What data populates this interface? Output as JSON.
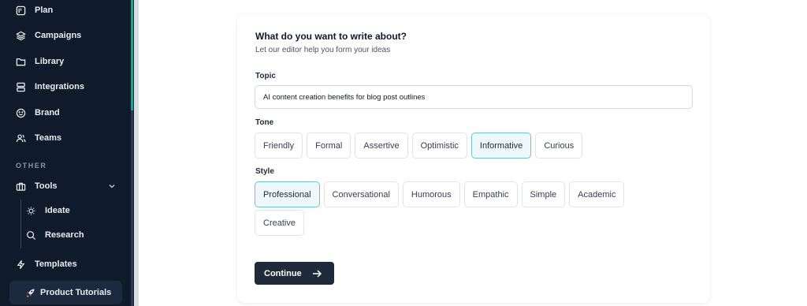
{
  "sidebar": {
    "items": [
      {
        "label": "Plan",
        "icon": "plan-icon"
      },
      {
        "label": "Campaigns",
        "icon": "layers-icon"
      },
      {
        "label": "Library",
        "icon": "folder-icon"
      },
      {
        "label": "Integrations",
        "icon": "integrations-icon"
      },
      {
        "label": "Brand",
        "icon": "smiley-icon"
      },
      {
        "label": "Teams",
        "icon": "users-icon"
      }
    ],
    "section_other": "OTHER",
    "tools": {
      "label": "Tools",
      "icon": "briefcase-icon"
    },
    "sub_items": [
      {
        "label": "Ideate",
        "icon": "lightbulb-icon"
      },
      {
        "label": "Research",
        "icon": "search-icon"
      }
    ],
    "templates": {
      "label": "Templates",
      "icon": "lightning-icon"
    },
    "product_tutorials": {
      "label": "Product Tutorials",
      "icon": "rocket-icon"
    }
  },
  "card": {
    "title": "What do you want to write about?",
    "subtitle": "Let our editor help you form your ideas",
    "topic_label": "Topic",
    "topic_value": "AI content creation benefits for blog post outlines",
    "tone_label": "Tone",
    "tones": [
      "Friendly",
      "Formal",
      "Assertive",
      "Optimistic",
      "Informative",
      "Curious"
    ],
    "selected_tone": "Informative",
    "style_label": "Style",
    "styles": [
      "Professional",
      "Conversational",
      "Humorous",
      "Empathic",
      "Simple",
      "Academic",
      "Creative"
    ],
    "selected_style": "Professional",
    "continue_label": "Continue"
  },
  "colors": {
    "sidebar_bg": "#0f1a2b",
    "accent": "#2a9d8f",
    "selected_chip_bg": "#eef8fa",
    "selected_chip_border": "#6fc3cf",
    "button_bg": "#1f2a3a"
  }
}
